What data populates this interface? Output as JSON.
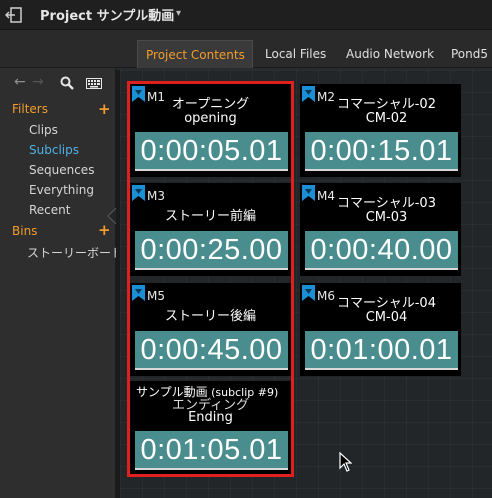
{
  "header": {
    "title": "Project サンプル動画",
    "caret": "▾"
  },
  "tabs": [
    {
      "label": "Project Contents",
      "active": true
    },
    {
      "label": "Local Files"
    },
    {
      "label": "Audio Network"
    },
    {
      "label": "Pond5"
    }
  ],
  "sidebar": {
    "nav_back": "←",
    "nav_forward": "→",
    "filters_heading": "Filters",
    "filters": [
      "Clips",
      "Subclips",
      "Sequences",
      "Everything",
      "Recent"
    ],
    "selected_filter": "Subclips",
    "bins_heading": "Bins",
    "plus": "+",
    "bins": [
      "ストーリーボード"
    ]
  },
  "clips": [
    {
      "id": "M1",
      "title": "オープニング",
      "subtitle": "opening",
      "timecode": "0:00:05.01"
    },
    {
      "id": "M2",
      "title": "コマーシャル-02",
      "subtitle": "CM-02",
      "timecode": "0:00:15.01"
    },
    {
      "id": "M3",
      "title": "ストーリー前編",
      "subtitle": "",
      "timecode": "0:00:25.00"
    },
    {
      "id": "M4",
      "title": "コマーシャル-03",
      "subtitle": "CM-03",
      "timecode": "0:00:40.00"
    },
    {
      "id": "M5",
      "title": "ストーリー後編",
      "subtitle": "",
      "timecode": "0:00:45.00"
    },
    {
      "id": "M6",
      "title": "コマーシャル-04",
      "subtitle": "CM-04",
      "timecode": "0:01:00.01"
    },
    {
      "id": "",
      "title": "エンディング",
      "subtitle": "Ending",
      "timecode": "0:01:05.01"
    }
  ],
  "tooltip": {
    "text": "サンプル動画",
    "sub": " (subclip #9)"
  },
  "colors": {
    "accent": "#f39c2d",
    "selected_filter": "#4fb1e8",
    "selection_border": "#e01f1f",
    "timecode_bg": "#4a8d8f"
  },
  "icons": {
    "exit": "exit-icon",
    "search": "search-icon",
    "keyboard": "keyboard-icon",
    "clip_badge": "clip-badge-icon",
    "cursor": "mouse-cursor-icon"
  }
}
